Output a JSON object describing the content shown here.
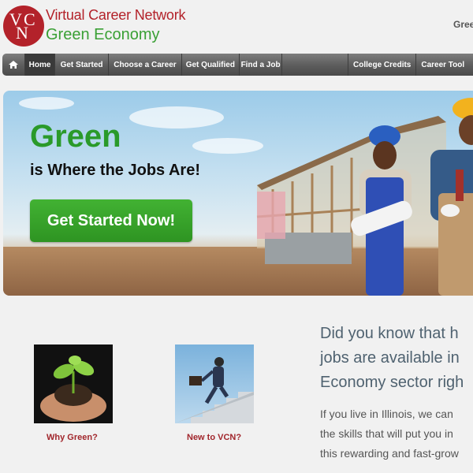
{
  "header": {
    "logo_letters": [
      "V",
      "C",
      "N"
    ],
    "brand_line1": "Virtual Career Network",
    "brand_line2": "Green Economy",
    "top_right": "Gree"
  },
  "nav": {
    "items": [
      "Home",
      "Get Started",
      "Choose a Career",
      "Get Qualified",
      "Find a Job",
      "College Credits",
      "Career Tool"
    ]
  },
  "hero": {
    "title": "Green",
    "subtitle": "is Where the Jobs Are!",
    "cta_label": "Get Started Now!"
  },
  "features": [
    {
      "caption": "Why Green?"
    },
    {
      "caption": "New to VCN?"
    }
  ],
  "intro": {
    "heading_lines": [
      "Did you know that h",
      "jobs are available in",
      "Economy sector righ"
    ],
    "body_lines": [
      "If you live in Illinois, we can",
      "the skills that will put you in",
      "this rewarding and fast-grow"
    ]
  },
  "colors": {
    "brand_red": "#b3222a",
    "brand_green": "#3aa035",
    "cta_green": "#2e9422",
    "nav_gray": "#5c5c5c"
  }
}
